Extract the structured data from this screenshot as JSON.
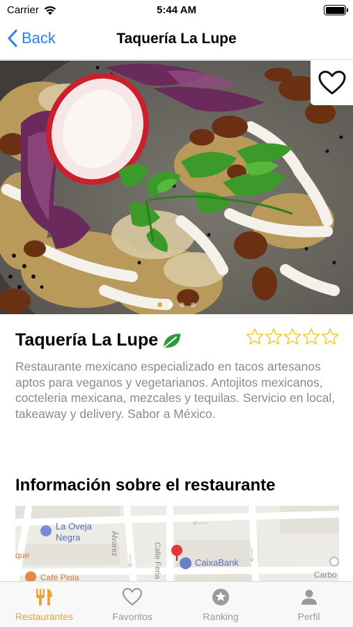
{
  "status_bar": {
    "carrier": "Carrier",
    "time": "5:44 AM"
  },
  "nav": {
    "back_label": "Back",
    "title": "Taquería La Lupe"
  },
  "hero": {
    "carousel_page": 1,
    "carousel_total": 4
  },
  "restaurant": {
    "name": "Taquería La Lupe",
    "rating_max": 5,
    "rating": 0,
    "description": "Restaurante mexicano especializado en tacos artesanos aptos para veganos y vegetarianos. Antojitos mexicanos, cocteleria mexicana, mezcales y tequilas. Servicio en local, takeaway y delivery. Sabor a México."
  },
  "info": {
    "title": "Información sobre el restaurante"
  },
  "map": {
    "labels": {
      "oveja": "La Oveja",
      "negra": "Negra",
      "caixa": "CaixaBank",
      "cafe": "Café Piola",
      "alvarez": "Álvarez",
      "feria": "Calle Feria",
      "que": "que",
      "carbo": "Carbo"
    }
  },
  "tabs": [
    {
      "label": "Restaurantes",
      "icon": "fork-knife-icon",
      "active": true
    },
    {
      "label": "Favoritos",
      "icon": "heart-icon",
      "active": false
    },
    {
      "label": "Ranking",
      "icon": "star-badge-icon",
      "active": false
    },
    {
      "label": "Perfil",
      "icon": "person-icon",
      "active": false
    }
  ],
  "colors": {
    "accent": "#e8a33a",
    "link": "#2f7cf6",
    "star": "#f5c518",
    "leaf": "#2e9b3a"
  }
}
